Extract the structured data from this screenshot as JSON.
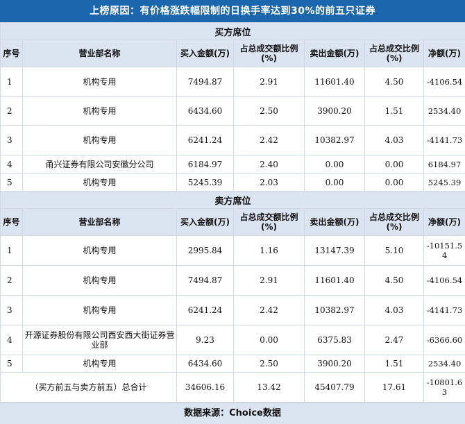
{
  "title": "上榜原因：有价格涨跌幅限制的日换手率达到30%的前五只证券",
  "colors": {
    "banner": "#1a67ae",
    "header_bg": "#dbe5f1",
    "border": "#d2d9e4"
  },
  "columns": [
    "序号",
    "营业部名称",
    "买入金额(万)",
    "占总成交额比例(%)",
    "卖出金额(万)",
    "占总成交比例(%)",
    "净额(万)"
  ],
  "buy_section": {
    "label": "买方席位",
    "rows": [
      {
        "idx": "1",
        "dept": "机构专用",
        "buy": "7494.87",
        "buy_pct": "2.91",
        "sell": "11601.40",
        "sell_pct": "4.50",
        "net": "-4106.54"
      },
      {
        "idx": "2",
        "dept": "机构专用",
        "buy": "6434.60",
        "buy_pct": "2.50",
        "sell": "3900.20",
        "sell_pct": "1.51",
        "net": "2534.40"
      },
      {
        "idx": "3",
        "dept": "机构专用",
        "buy": "6241.24",
        "buy_pct": "2.42",
        "sell": "10382.97",
        "sell_pct": "4.03",
        "net": "-4141.73"
      },
      {
        "idx": "4",
        "dept": "甬兴证券有限公司安徽分公司",
        "buy": "6184.97",
        "buy_pct": "2.40",
        "sell": "0.00",
        "sell_pct": "0.00",
        "net": "6184.97"
      },
      {
        "idx": "5",
        "dept": "机构专用",
        "buy": "5245.39",
        "buy_pct": "2.03",
        "sell": "0.00",
        "sell_pct": "0.00",
        "net": "5245.39"
      }
    ]
  },
  "sell_section": {
    "label": "卖方席位",
    "rows": [
      {
        "idx": "1",
        "dept": "机构专用",
        "buy": "2995.84",
        "buy_pct": "1.16",
        "sell": "13147.39",
        "sell_pct": "5.10",
        "net": "-10151.54"
      },
      {
        "idx": "2",
        "dept": "机构专用",
        "buy": "7494.87",
        "buy_pct": "2.91",
        "sell": "11601.40",
        "sell_pct": "4.50",
        "net": "-4106.54"
      },
      {
        "idx": "3",
        "dept": "机构专用",
        "buy": "6241.24",
        "buy_pct": "2.42",
        "sell": "10382.97",
        "sell_pct": "4.03",
        "net": "-4141.73"
      },
      {
        "idx": "4",
        "dept": "开源证券股份有限公司西安西大街证券营业部",
        "buy": "9.23",
        "buy_pct": "0.00",
        "sell": "6375.83",
        "sell_pct": "2.47",
        "net": "-6366.60"
      },
      {
        "idx": "5",
        "dept": "机构专用",
        "buy": "6434.60",
        "buy_pct": "2.50",
        "sell": "3900.20",
        "sell_pct": "1.51",
        "net": "2534.40"
      }
    ]
  },
  "total": {
    "label": "（买方前五与卖方前五）总合计",
    "buy": "34606.16",
    "buy_pct": "13.42",
    "sell": "45407.79",
    "sell_pct": "17.61",
    "net": "-10801.63"
  },
  "source": "数据来源：Choice数据"
}
